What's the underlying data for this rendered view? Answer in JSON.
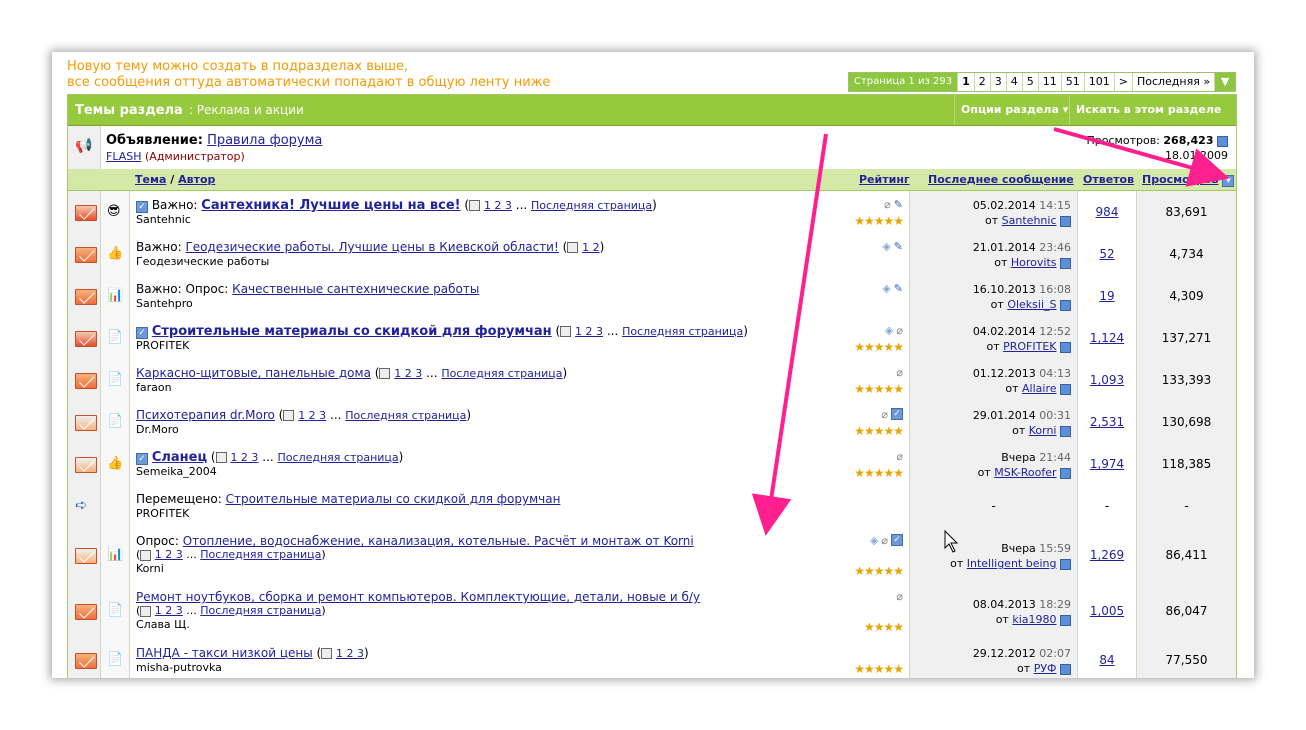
{
  "notice": {
    "line1": "Новую тему можно создать в подразделах выше,",
    "line2": "все сообщения оттуда автоматически попадают в общую ленту ниже"
  },
  "pager": {
    "info": "Страница 1 из 293",
    "pages": [
      "1",
      "2",
      "3",
      "4",
      "5",
      "11",
      "51",
      "101"
    ],
    "next": ">",
    "last": "Последняя »"
  },
  "section": {
    "title": "Темы раздела",
    "subtitle": ": Реклама и акции",
    "options_label": "Опции раздела",
    "search_label": "Искать в этом разделе"
  },
  "announcement": {
    "prefix": "Объявление:",
    "title": "Правила форума",
    "author": "FLASH",
    "role": "(Администратор)",
    "views_label": "Просмотров:",
    "views": "268,423",
    "date": "18.01.2009"
  },
  "columns": {
    "topic": "Тема",
    "sep": "/",
    "author": "Автор",
    "rating": "Рейтинг",
    "last": "Последнее сообщение",
    "replies": "Ответов",
    "views": "Просмотров"
  },
  "rows": [
    {
      "prefix": "Важно:",
      "title": "Сантехника! Лучшие цены на все!",
      "pages": "1 2 3",
      "last_page": "Последняя страница",
      "author": "Santehnic",
      "date": "05.02.2014",
      "time": "14:15",
      "by": "Santehnic",
      "replies": "984",
      "views": "83,691",
      "stars": "★★★★★"
    },
    {
      "prefix": "Важно:",
      "title": "Геодезические работы. Лучшие цены в Киевской области!",
      "pages": "1 2",
      "last_page": "",
      "author": "Геодезические работы",
      "date": "21.01.2014",
      "time": "23:46",
      "by": "Horovits",
      "replies": "52",
      "views": "4,734",
      "stars": ""
    },
    {
      "prefix": "Важно: Опрос:",
      "title": "Качественные сантехнические работы",
      "pages": "",
      "last_page": "",
      "author": "Santehpro",
      "date": "16.10.2013",
      "time": "16:08",
      "by": "Oleksii_S",
      "replies": "19",
      "views": "4,309",
      "stars": ""
    },
    {
      "prefix": "",
      "title": "Строительные материалы со скидкой для форумчан",
      "pages": "1 2 3",
      "last_page": "Последняя страница",
      "author": "PROFITEK",
      "date": "04.02.2014",
      "time": "12:52",
      "by": "PROFITEK",
      "replies": "1,124",
      "views": "137,271",
      "stars": "★★★★★"
    },
    {
      "prefix": "",
      "title": "Каркасно-щитовые, панельные дома",
      "pages": "1 2 3",
      "last_page": "Последняя страница",
      "author": "faraon",
      "date": "01.12.2013",
      "time": "04:13",
      "by": "Allaire",
      "replies": "1,093",
      "views": "133,393",
      "stars": "★★★★★"
    },
    {
      "prefix": "",
      "title": "Психотерапия dr.Moro",
      "pages": "1 2 3",
      "last_page": "Последняя страница",
      "author": "Dr.Moro",
      "date": "29.01.2014",
      "time": "00:31",
      "by": "Korni",
      "replies": "2,531",
      "views": "130,698",
      "stars": "★★★★★"
    },
    {
      "prefix": "",
      "title": "Сланец",
      "pages": "1 2 3",
      "last_page": "Последняя страница",
      "author": "Semeika_2004",
      "date": "Вчера",
      "time": "21:44",
      "by": "MSK-Roofer",
      "replies": "1,974",
      "views": "118,385",
      "stars": "★★★★★"
    },
    {
      "prefix": "Перемещено:",
      "title": "Строительные материалы со скидкой для форумчан",
      "pages": "",
      "last_page": "",
      "author": "PROFITEK",
      "date": "",
      "time": "",
      "by": "",
      "replies": "-",
      "views": "-",
      "last_dash": "-",
      "stars": ""
    },
    {
      "prefix": "Опрос:",
      "title": "Отопление, водоснабжение, канализация, котельные. Расчёт и монтаж от Korni",
      "pages": "1 2 3",
      "last_page": "Последняя страница",
      "author": "Korni",
      "date": "Вчера",
      "time": "15:59",
      "by": "Intelligent being",
      "replies": "1,269",
      "views": "86,411",
      "stars": "★★★★★"
    },
    {
      "prefix": "",
      "title": "Ремонт ноутбуков, сборка и ремонт компьютеров. Комплектующие, детали, новые и б/у",
      "pages": "1 2 3",
      "last_page": "Последняя страница",
      "author": "Слава Щ.",
      "date": "08.04.2013",
      "time": "18:29",
      "by": "kia1980",
      "replies": "1,005",
      "views": "86,047",
      "stars": "★★★★"
    },
    {
      "prefix": "",
      "title": "ПАНДА - такси низкой цены",
      "pages": "1 2 3",
      "last_page": "",
      "author": "misha-putrovka",
      "date": "29.12.2012",
      "time": "02:07",
      "by": "РУФ",
      "replies": "84",
      "views": "77,550",
      "stars": "★★★★★"
    }
  ],
  "labels": {
    "by": "от"
  },
  "colors": {
    "accent": "#97c93f",
    "notice": "#f39b00",
    "link": "#22229c",
    "annotation": "#ff1f8e"
  }
}
